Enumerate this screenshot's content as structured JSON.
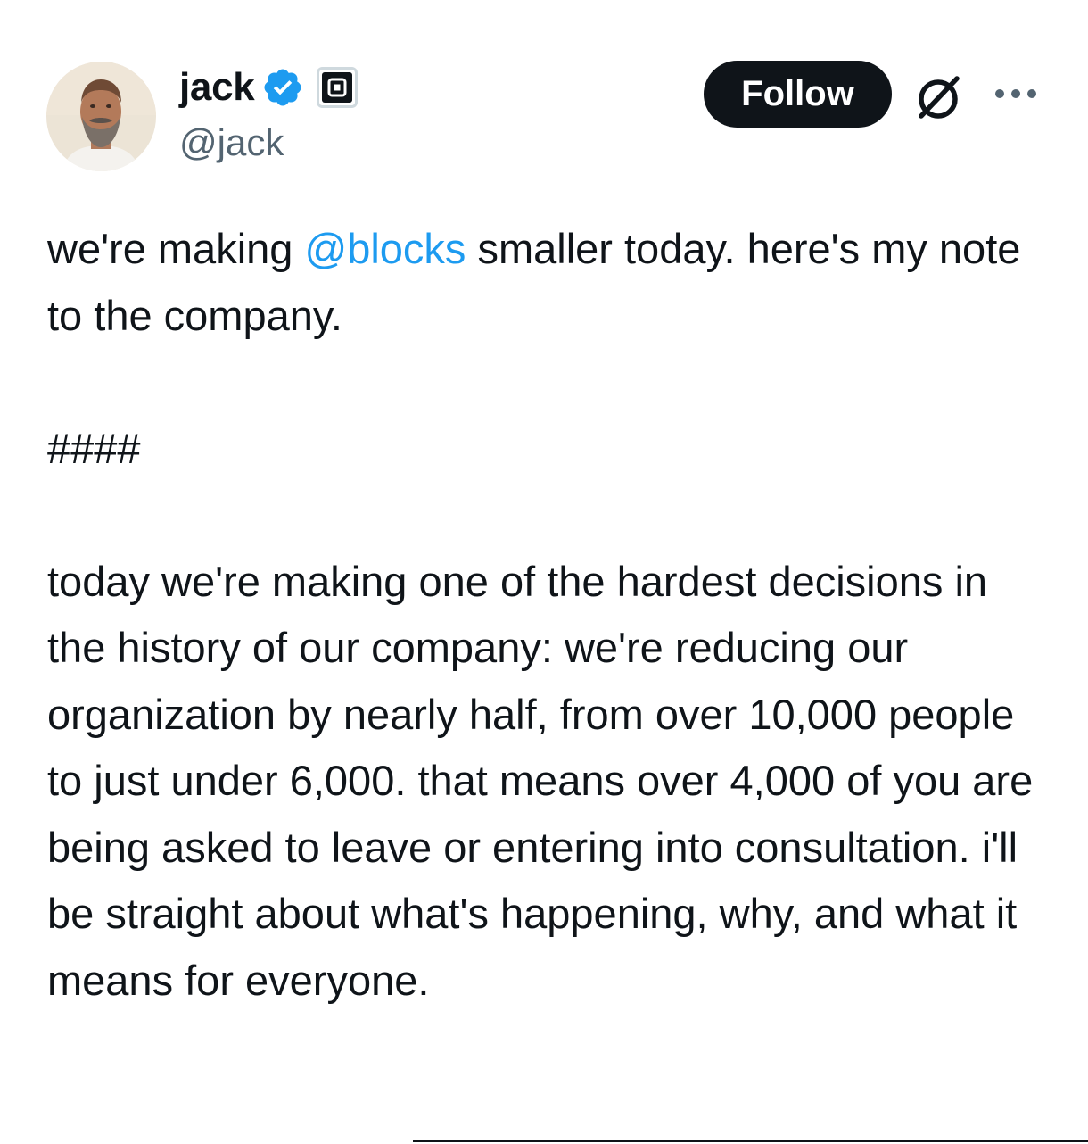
{
  "author": {
    "display_name": "jack",
    "handle": "@jack",
    "avatar_icon": "profile-photo",
    "verified_icon": "verified-badge-icon",
    "affiliate_icon": "block-logo-icon"
  },
  "actions": {
    "follow_label": "Follow",
    "grok_icon": "grok-icon",
    "more_icon": "more-options-icon"
  },
  "tweet": {
    "intro_before_mention": "we're making ",
    "mention": "@blocks",
    "intro_after_mention": " smaller today. here's my note to the company.",
    "separator": "####",
    "body": "today we're making one of the hardest decisions in the history of our company: we're reducing our organization by nearly half, from over 10,000 people to just under 6,000. that means over 4,000 of you are being asked to leave or entering into consultation. i'll be straight about what's happening, why, and what it means for everyone."
  },
  "colors": {
    "text": "#0f1419",
    "secondary_text": "#536471",
    "link": "#1d9bf0",
    "verified": "#1d9bf0",
    "follow_button_bg": "#0f1419",
    "follow_button_text": "#ffffff"
  }
}
